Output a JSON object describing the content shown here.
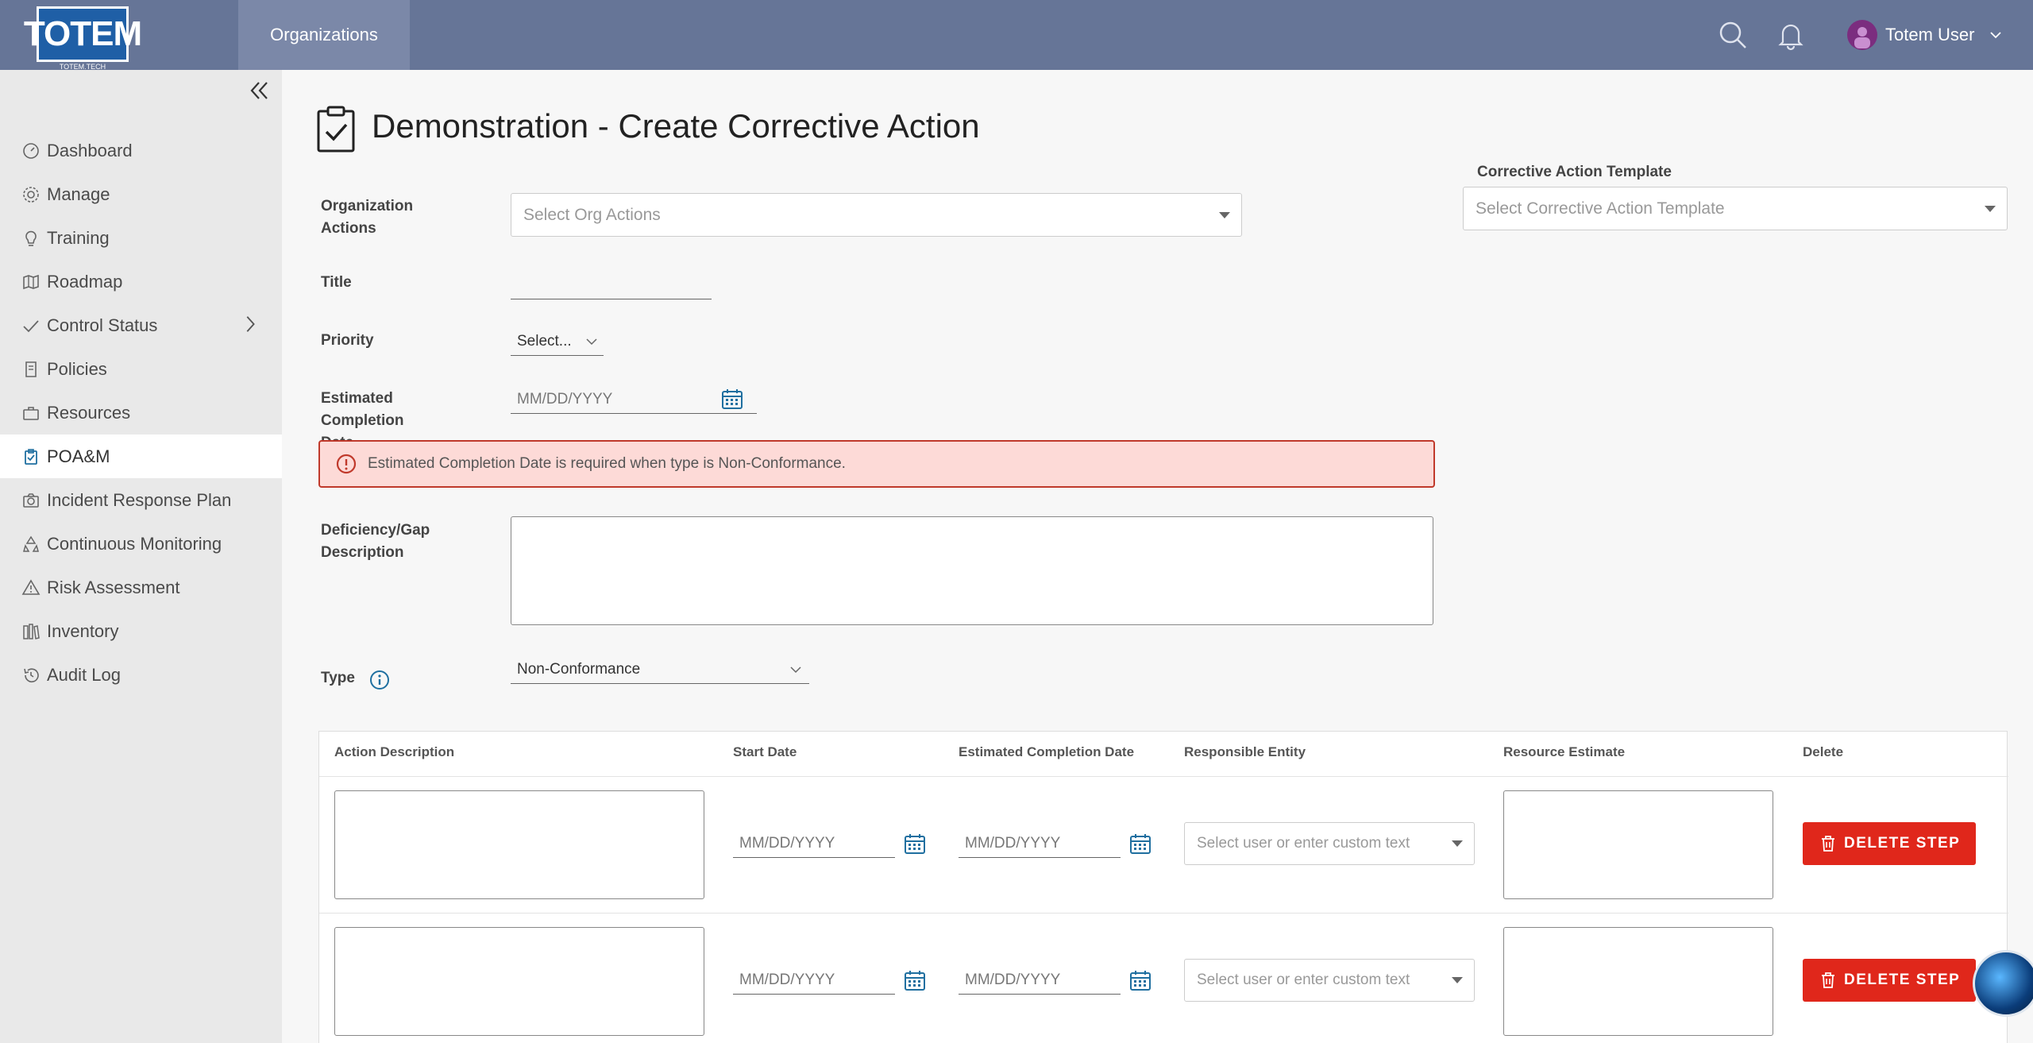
{
  "header": {
    "logo_text": "TOTEM",
    "logo_sub": "TOTEM.TECH",
    "nav_tab": "Organizations",
    "user_name": "Totem User",
    "bg_color": "#667597"
  },
  "sidebar": {
    "items": [
      {
        "label": "Dashboard",
        "icon": "gauge-icon"
      },
      {
        "label": "Manage",
        "icon": "gear-icon"
      },
      {
        "label": "Training",
        "icon": "lightbulb-icon"
      },
      {
        "label": "Roadmap",
        "icon": "map-icon"
      },
      {
        "label": "Control Status",
        "icon": "check-icon"
      },
      {
        "label": "Policies",
        "icon": "scroll-icon"
      },
      {
        "label": "Resources",
        "icon": "briefcase-icon"
      },
      {
        "label": "POA&M",
        "icon": "clipboard-check-icon"
      },
      {
        "label": "Incident Response Plan",
        "icon": "camera-icon"
      },
      {
        "label": "Continuous Monitoring",
        "icon": "recycle-icon"
      },
      {
        "label": "Risk Assessment",
        "icon": "warning-icon"
      },
      {
        "label": "Inventory",
        "icon": "inventory-icon"
      },
      {
        "label": "Audit Log",
        "icon": "history-icon"
      }
    ],
    "active": "POA&M"
  },
  "page": {
    "title": "Demonstration - Create Corrective Action"
  },
  "form": {
    "org_actions_label": "Organization Actions",
    "org_actions_placeholder": "Select Org Actions",
    "title_label": "Title",
    "title_value": "",
    "priority_label": "Priority",
    "priority_value": "Select...",
    "ecd_label": "Estimated Completion Date",
    "ecd_placeholder": "MM/DD/YYYY",
    "error_message": "Estimated Completion Date is required when type is Non-Conformance.",
    "deficiency_label": "Deficiency/Gap Description",
    "type_label": "Type",
    "type_value": "Non-Conformance",
    "template_label": "Corrective Action Template",
    "template_placeholder": "Select Corrective Action Template"
  },
  "steps_table": {
    "columns": [
      "Action Description",
      "Start Date",
      "Estimated Completion Date",
      "Responsible Entity",
      "Resource Estimate",
      "Delete"
    ],
    "rows": [
      {
        "start_date": "MM/DD/YYYY",
        "ecd": "MM/DD/YYYY",
        "entity_placeholder": "Select user or enter custom text",
        "delete_label": "DELETE STEP"
      },
      {
        "start_date": "MM/DD/YYYY",
        "ecd": "MM/DD/YYYY",
        "entity_placeholder": "Select user or enter custom text",
        "delete_label": "DELETE STEP"
      }
    ]
  },
  "colors": {
    "accent": "#1f6fa0",
    "danger": "#e0271b",
    "error_bg": "#fddad7"
  }
}
